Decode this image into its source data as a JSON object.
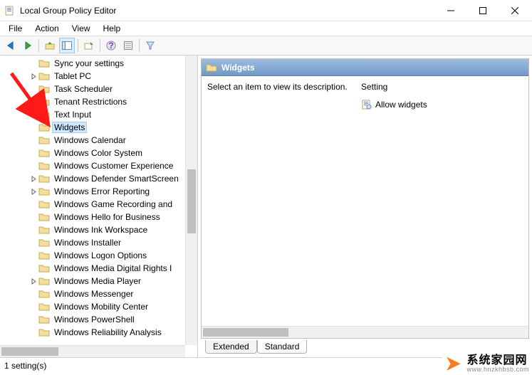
{
  "window": {
    "title": "Local Group Policy Editor"
  },
  "menu": {
    "file": "File",
    "action": "Action",
    "view": "View",
    "help": "Help"
  },
  "tree": {
    "items": [
      {
        "label": "Sync your settings",
        "expander": false
      },
      {
        "label": "Tablet PC",
        "expander": true
      },
      {
        "label": "Task Scheduler",
        "expander": false
      },
      {
        "label": "Tenant Restrictions",
        "expander": false
      },
      {
        "label": "Text Input",
        "expander": false
      },
      {
        "label": "Widgets",
        "expander": false,
        "selected": true
      },
      {
        "label": "Windows Calendar",
        "expander": false
      },
      {
        "label": "Windows Color System",
        "expander": false
      },
      {
        "label": "Windows Customer Experience",
        "expander": false
      },
      {
        "label": "Windows Defender SmartScreen",
        "expander": true
      },
      {
        "label": "Windows Error Reporting",
        "expander": true
      },
      {
        "label": "Windows Game Recording and",
        "expander": false
      },
      {
        "label": "Windows Hello for Business",
        "expander": false
      },
      {
        "label": "Windows Ink Workspace",
        "expander": false
      },
      {
        "label": "Windows Installer",
        "expander": false
      },
      {
        "label": "Windows Logon Options",
        "expander": false
      },
      {
        "label": "Windows Media Digital Rights I",
        "expander": false
      },
      {
        "label": "Windows Media Player",
        "expander": true
      },
      {
        "label": "Windows Messenger",
        "expander": false
      },
      {
        "label": "Windows Mobility Center",
        "expander": false
      },
      {
        "label": "Windows PowerShell",
        "expander": false
      },
      {
        "label": "Windows Reliability Analysis",
        "expander": false
      }
    ]
  },
  "details": {
    "header": "Widgets",
    "hint": "Select an item to view its description.",
    "col_setting": "Setting",
    "settings": [
      {
        "label": "Allow widgets"
      }
    ]
  },
  "tabs": {
    "extended": "Extended",
    "standard": "Standard"
  },
  "status": {
    "text": "1 setting(s)"
  },
  "watermark": {
    "text": "系统家园网",
    "sub": "www.hnzkhbsb.com"
  }
}
